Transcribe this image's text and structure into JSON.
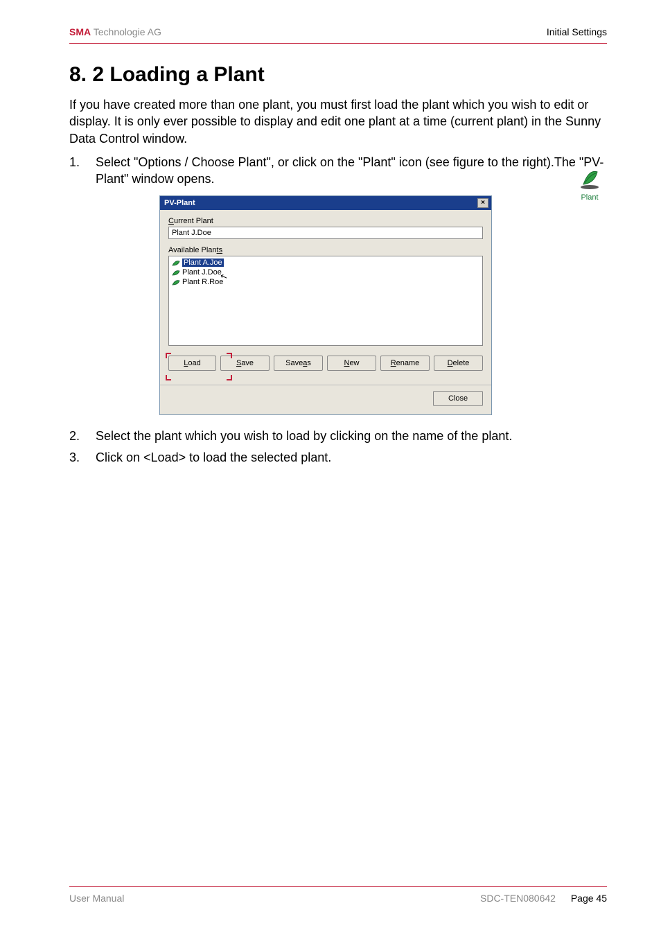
{
  "header": {
    "brand": "SMA",
    "brand_rest": " Technologie AG",
    "right": "Initial Settings"
  },
  "section": {
    "title": "8. 2 Loading a Plant",
    "intro": "If you have created more than one plant, you must first load the plant which you wish to edit or display. It is only ever possible to display and edit one plant at a time (current plant) in the Sunny Data Control window.",
    "step1_num": "1.",
    "step1": "Select \"Options / Choose Plant\", or click on the \"Plant\" icon (see figure to the right).The \"PV-Plant\" window opens.",
    "step2_num": "2.",
    "step2": "Select the plant which you wish to load by clicking on the name of the plant.",
    "step3_num": "3.",
    "step3": "Click on <Load> to load the selected plant."
  },
  "plant_icon": {
    "label": "Plant"
  },
  "dialog": {
    "title": "PV-Plant",
    "close_x": "×",
    "current_label_pre": "C",
    "current_label_post": "urrent Plant",
    "current_value": "Plant J.Doe",
    "available_pre": "Available Plan",
    "available_post": "ts",
    "items": [
      {
        "label": "Plant A.Joe",
        "selected": true
      },
      {
        "label": "Plant J.Doe",
        "selected": false
      },
      {
        "label": "Plant R.Roe",
        "selected": false
      }
    ],
    "buttons": {
      "load_pre": "L",
      "load_post": "oad",
      "save_pre": "S",
      "save_post": "ave",
      "saveas_pre": "",
      "saveas_mid": "Save ",
      "saveas_u": "a",
      "saveas_post": "s",
      "new_pre": "N",
      "new_post": "ew",
      "rename_pre": "R",
      "rename_post": "ename",
      "delete_pre": "D",
      "delete_post": "elete",
      "close": "Close"
    }
  },
  "footer": {
    "left": "User Manual",
    "code": "SDC-TEN080642",
    "page": "Page 45"
  }
}
